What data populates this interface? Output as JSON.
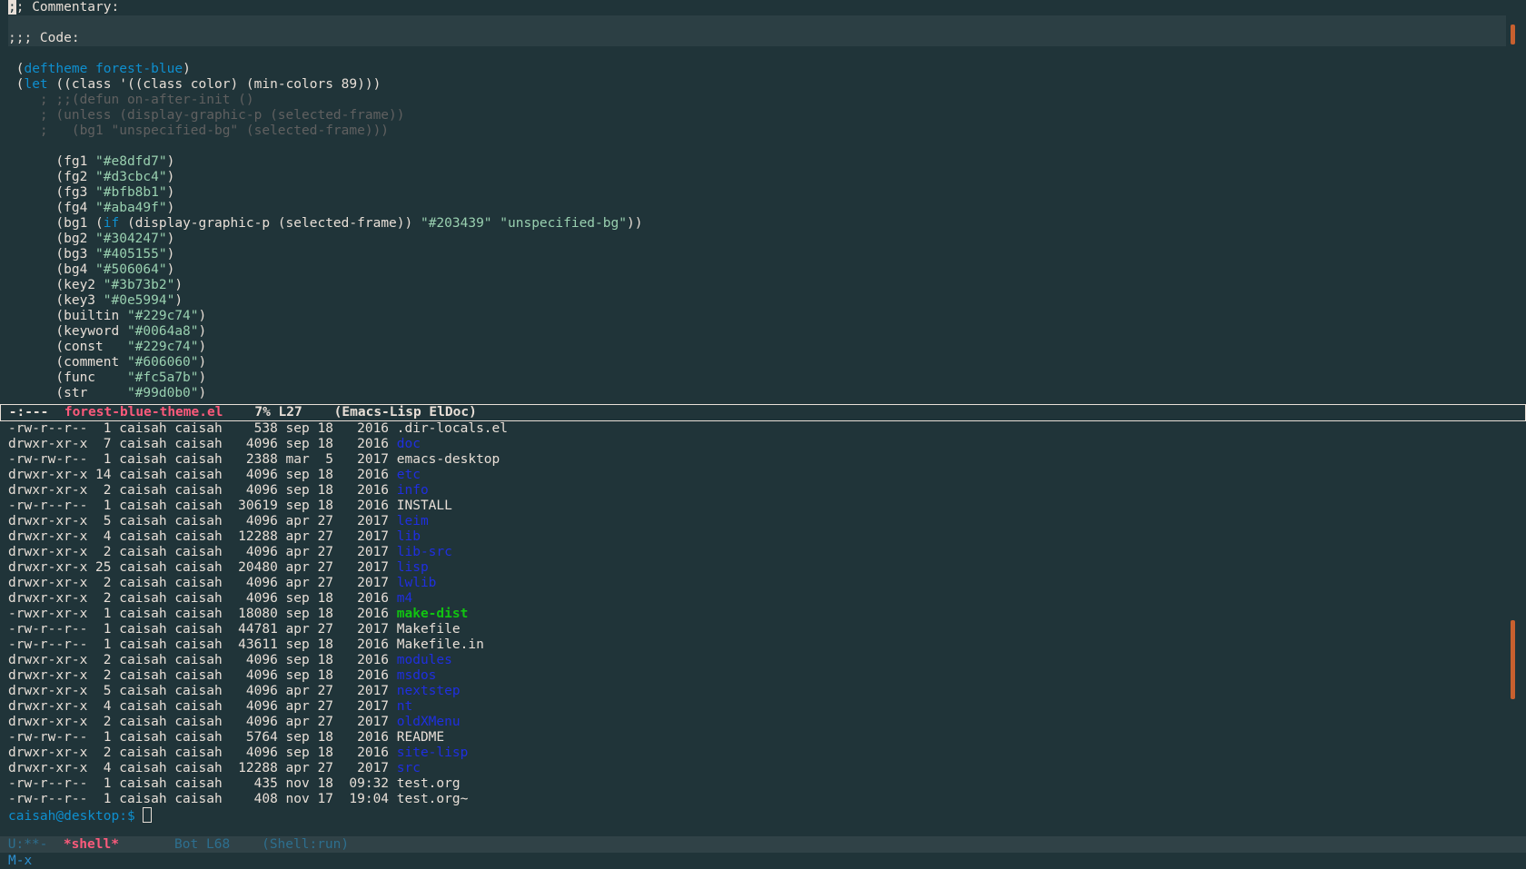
{
  "editor": {
    "lines": [
      {
        "cls": "",
        "segments": [
          {
            "t": ";",
            "c": "cursor-first"
          },
          {
            "t": "; Commentary:",
            "c": ""
          }
        ]
      },
      {
        "cls": "hl",
        "segments": [
          {
            "t": "",
            "c": ""
          }
        ]
      },
      {
        "cls": "hl",
        "segments": [
          {
            "t": ";;; Code:",
            "c": ""
          }
        ]
      },
      {
        "cls": "",
        "segments": [
          {
            "t": "",
            "c": ""
          }
        ]
      },
      {
        "cls": "",
        "segments": [
          {
            "t": " (",
            "c": ""
          },
          {
            "t": "deftheme",
            "c": "kw2"
          },
          {
            "t": " ",
            "c": ""
          },
          {
            "t": "forest-blue",
            "c": "kw2"
          },
          {
            "t": ")",
            "c": ""
          }
        ]
      },
      {
        "cls": "",
        "segments": [
          {
            "t": " (",
            "c": ""
          },
          {
            "t": "let",
            "c": "kw2"
          },
          {
            "t": " ((class '((class color) (min-colors 89)))",
            "c": ""
          }
        ]
      },
      {
        "cls": "",
        "segments": [
          {
            "t": "    ; ;;(defun on-after-init ()",
            "c": "com"
          }
        ]
      },
      {
        "cls": "",
        "segments": [
          {
            "t": "    ; (unless (display-graphic-p (selected-frame))",
            "c": "com"
          }
        ]
      },
      {
        "cls": "",
        "segments": [
          {
            "t": "    ;   (bg1 \"unspecified-bg\" (selected-frame)))",
            "c": "com"
          }
        ]
      },
      {
        "cls": "",
        "segments": [
          {
            "t": "",
            "c": ""
          }
        ]
      },
      {
        "cls": "",
        "segments": [
          {
            "t": "      (fg1 ",
            "c": ""
          },
          {
            "t": "\"#e8dfd7\"",
            "c": "str"
          },
          {
            "t": ")",
            "c": ""
          }
        ]
      },
      {
        "cls": "",
        "segments": [
          {
            "t": "      (fg2 ",
            "c": ""
          },
          {
            "t": "\"#d3cbc4\"",
            "c": "str"
          },
          {
            "t": ")",
            "c": ""
          }
        ]
      },
      {
        "cls": "",
        "segments": [
          {
            "t": "      (fg3 ",
            "c": ""
          },
          {
            "t": "\"#bfb8b1\"",
            "c": "str"
          },
          {
            "t": ")",
            "c": ""
          }
        ]
      },
      {
        "cls": "",
        "segments": [
          {
            "t": "      (fg4 ",
            "c": ""
          },
          {
            "t": "\"#aba49f\"",
            "c": "str"
          },
          {
            "t": ")",
            "c": ""
          }
        ]
      },
      {
        "cls": "",
        "segments": [
          {
            "t": "      (bg1 (",
            "c": ""
          },
          {
            "t": "if",
            "c": "kw2"
          },
          {
            "t": " (display-graphic-p (selected-frame)) ",
            "c": ""
          },
          {
            "t": "\"#203439\"",
            "c": "str"
          },
          {
            "t": " ",
            "c": ""
          },
          {
            "t": "\"unspecified-bg\"",
            "c": "str"
          },
          {
            "t": "))",
            "c": ""
          }
        ]
      },
      {
        "cls": "",
        "segments": [
          {
            "t": "      (bg2 ",
            "c": ""
          },
          {
            "t": "\"#304247\"",
            "c": "str"
          },
          {
            "t": ")",
            "c": ""
          }
        ]
      },
      {
        "cls": "",
        "segments": [
          {
            "t": "      (bg3 ",
            "c": ""
          },
          {
            "t": "\"#405155\"",
            "c": "str"
          },
          {
            "t": ")",
            "c": ""
          }
        ]
      },
      {
        "cls": "",
        "segments": [
          {
            "t": "      (bg4 ",
            "c": ""
          },
          {
            "t": "\"#506064\"",
            "c": "str"
          },
          {
            "t": ")",
            "c": ""
          }
        ]
      },
      {
        "cls": "",
        "segments": [
          {
            "t": "      (key2 ",
            "c": ""
          },
          {
            "t": "\"#3b73b2\"",
            "c": "str"
          },
          {
            "t": ")",
            "c": ""
          }
        ]
      },
      {
        "cls": "",
        "segments": [
          {
            "t": "      (key3 ",
            "c": ""
          },
          {
            "t": "\"#0e5994\"",
            "c": "str"
          },
          {
            "t": ")",
            "c": ""
          }
        ]
      },
      {
        "cls": "",
        "segments": [
          {
            "t": "      (builtin ",
            "c": ""
          },
          {
            "t": "\"#229c74\"",
            "c": "str"
          },
          {
            "t": ")",
            "c": ""
          }
        ]
      },
      {
        "cls": "",
        "segments": [
          {
            "t": "      (keyword ",
            "c": ""
          },
          {
            "t": "\"#0064a8\"",
            "c": "str"
          },
          {
            "t": ")",
            "c": ""
          }
        ]
      },
      {
        "cls": "",
        "segments": [
          {
            "t": "      (const   ",
            "c": ""
          },
          {
            "t": "\"#229c74\"",
            "c": "str"
          },
          {
            "t": ")",
            "c": ""
          }
        ]
      },
      {
        "cls": "",
        "segments": [
          {
            "t": "      (comment ",
            "c": ""
          },
          {
            "t": "\"#606060\"",
            "c": "str"
          },
          {
            "t": ")",
            "c": ""
          }
        ]
      },
      {
        "cls": "",
        "segments": [
          {
            "t": "      (func    ",
            "c": ""
          },
          {
            "t": "\"#fc5a7b\"",
            "c": "str"
          },
          {
            "t": ")",
            "c": ""
          }
        ]
      },
      {
        "cls": "",
        "segments": [
          {
            "t": "      (str     ",
            "c": ""
          },
          {
            "t": "\"#99d0b0\"",
            "c": "str"
          },
          {
            "t": ")",
            "c": ""
          }
        ]
      }
    ]
  },
  "top_modeline": {
    "status": " -:---  ",
    "buffer": "forest-blue-theme.el",
    "position": "    7% L27    ",
    "modes": "(Emacs-Lisp ElDoc)"
  },
  "shell": {
    "rows": [
      {
        "perms": "-rw-r--r--",
        "links": "1",
        "user": "caisah",
        "group": "caisah",
        "size": "538",
        "month": "sep",
        "day": "18",
        "time": "2016",
        "name": ".dir-locals.el",
        "kind": "file"
      },
      {
        "perms": "drwxr-xr-x",
        "links": "7",
        "user": "caisah",
        "group": "caisah",
        "size": "4096",
        "month": "sep",
        "day": "18",
        "time": "2016",
        "name": "doc",
        "kind": "dir"
      },
      {
        "perms": "-rw-rw-r--",
        "links": "1",
        "user": "caisah",
        "group": "caisah",
        "size": "2388",
        "month": "mar",
        "day": "5",
        "time": "2017",
        "name": "emacs-desktop",
        "kind": "file"
      },
      {
        "perms": "drwxr-xr-x",
        "links": "14",
        "user": "caisah",
        "group": "caisah",
        "size": "4096",
        "month": "sep",
        "day": "18",
        "time": "2016",
        "name": "etc",
        "kind": "dir"
      },
      {
        "perms": "drwxr-xr-x",
        "links": "2",
        "user": "caisah",
        "group": "caisah",
        "size": "4096",
        "month": "sep",
        "day": "18",
        "time": "2016",
        "name": "info",
        "kind": "dir"
      },
      {
        "perms": "-rw-r--r--",
        "links": "1",
        "user": "caisah",
        "group": "caisah",
        "size": "30619",
        "month": "sep",
        "day": "18",
        "time": "2016",
        "name": "INSTALL",
        "kind": "file"
      },
      {
        "perms": "drwxr-xr-x",
        "links": "5",
        "user": "caisah",
        "group": "caisah",
        "size": "4096",
        "month": "apr",
        "day": "27",
        "time": "2017",
        "name": "leim",
        "kind": "dir"
      },
      {
        "perms": "drwxr-xr-x",
        "links": "4",
        "user": "caisah",
        "group": "caisah",
        "size": "12288",
        "month": "apr",
        "day": "27",
        "time": "2017",
        "name": "lib",
        "kind": "dir"
      },
      {
        "perms": "drwxr-xr-x",
        "links": "2",
        "user": "caisah",
        "group": "caisah",
        "size": "4096",
        "month": "apr",
        "day": "27",
        "time": "2017",
        "name": "lib-src",
        "kind": "dir"
      },
      {
        "perms": "drwxr-xr-x",
        "links": "25",
        "user": "caisah",
        "group": "caisah",
        "size": "20480",
        "month": "apr",
        "day": "27",
        "time": "2017",
        "name": "lisp",
        "kind": "dir"
      },
      {
        "perms": "drwxr-xr-x",
        "links": "2",
        "user": "caisah",
        "group": "caisah",
        "size": "4096",
        "month": "apr",
        "day": "27",
        "time": "2017",
        "name": "lwlib",
        "kind": "dir"
      },
      {
        "perms": "drwxr-xr-x",
        "links": "2",
        "user": "caisah",
        "group": "caisah",
        "size": "4096",
        "month": "sep",
        "day": "18",
        "time": "2016",
        "name": "m4",
        "kind": "dir"
      },
      {
        "perms": "-rwxr-xr-x",
        "links": "1",
        "user": "caisah",
        "group": "caisah",
        "size": "18080",
        "month": "sep",
        "day": "18",
        "time": "2016",
        "name": "make-dist",
        "kind": "exe"
      },
      {
        "perms": "-rw-r--r--",
        "links": "1",
        "user": "caisah",
        "group": "caisah",
        "size": "44781",
        "month": "apr",
        "day": "27",
        "time": "2017",
        "name": "Makefile",
        "kind": "file"
      },
      {
        "perms": "-rw-r--r--",
        "links": "1",
        "user": "caisah",
        "group": "caisah",
        "size": "43611",
        "month": "sep",
        "day": "18",
        "time": "2016",
        "name": "Makefile.in",
        "kind": "file"
      },
      {
        "perms": "drwxr-xr-x",
        "links": "2",
        "user": "caisah",
        "group": "caisah",
        "size": "4096",
        "month": "sep",
        "day": "18",
        "time": "2016",
        "name": "modules",
        "kind": "dir"
      },
      {
        "perms": "drwxr-xr-x",
        "links": "2",
        "user": "caisah",
        "group": "caisah",
        "size": "4096",
        "month": "sep",
        "day": "18",
        "time": "2016",
        "name": "msdos",
        "kind": "dir"
      },
      {
        "perms": "drwxr-xr-x",
        "links": "5",
        "user": "caisah",
        "group": "caisah",
        "size": "4096",
        "month": "apr",
        "day": "27",
        "time": "2017",
        "name": "nextstep",
        "kind": "dir"
      },
      {
        "perms": "drwxr-xr-x",
        "links": "4",
        "user": "caisah",
        "group": "caisah",
        "size": "4096",
        "month": "apr",
        "day": "27",
        "time": "2017",
        "name": "nt",
        "kind": "dir"
      },
      {
        "perms": "drwxr-xr-x",
        "links": "2",
        "user": "caisah",
        "group": "caisah",
        "size": "4096",
        "month": "apr",
        "day": "27",
        "time": "2017",
        "name": "oldXMenu",
        "kind": "dir"
      },
      {
        "perms": "-rw-rw-r--",
        "links": "1",
        "user": "caisah",
        "group": "caisah",
        "size": "5764",
        "month": "sep",
        "day": "18",
        "time": "2016",
        "name": "README",
        "kind": "file"
      },
      {
        "perms": "drwxr-xr-x",
        "links": "2",
        "user": "caisah",
        "group": "caisah",
        "size": "4096",
        "month": "sep",
        "day": "18",
        "time": "2016",
        "name": "site-lisp",
        "kind": "dir"
      },
      {
        "perms": "drwxr-xr-x",
        "links": "4",
        "user": "caisah",
        "group": "caisah",
        "size": "12288",
        "month": "apr",
        "day": "27",
        "time": "2017",
        "name": "src",
        "kind": "dir"
      },
      {
        "perms": "-rw-r--r--",
        "links": "1",
        "user": "caisah",
        "group": "caisah",
        "size": "435",
        "month": "nov",
        "day": "18",
        "time": "09:32",
        "name": "test.org",
        "kind": "file"
      },
      {
        "perms": "-rw-r--r--",
        "links": "1",
        "user": "caisah",
        "group": "caisah",
        "size": "408",
        "month": "nov",
        "day": "17",
        "time": "19:04",
        "name": "test.org~",
        "kind": "file"
      }
    ],
    "prompt": "caisah@desktop:$ "
  },
  "bottom_modeline": {
    "status": " U:**-  ",
    "buffer": "*shell*",
    "position": "       Bot L68    ",
    "modes": "(Shell:run)"
  },
  "minibuffer": {
    "text": "M-x"
  },
  "colors": {
    "background": "#203439",
    "foreground": "#e8dfd7",
    "keyword": "#0e8fcf",
    "string": "#99d0b0",
    "comment": "#606060",
    "directory": "#1f2fe0",
    "executable": "#11c411",
    "buffer_name": "#fc5a7b",
    "scroll_thumb": "#c8602f"
  }
}
